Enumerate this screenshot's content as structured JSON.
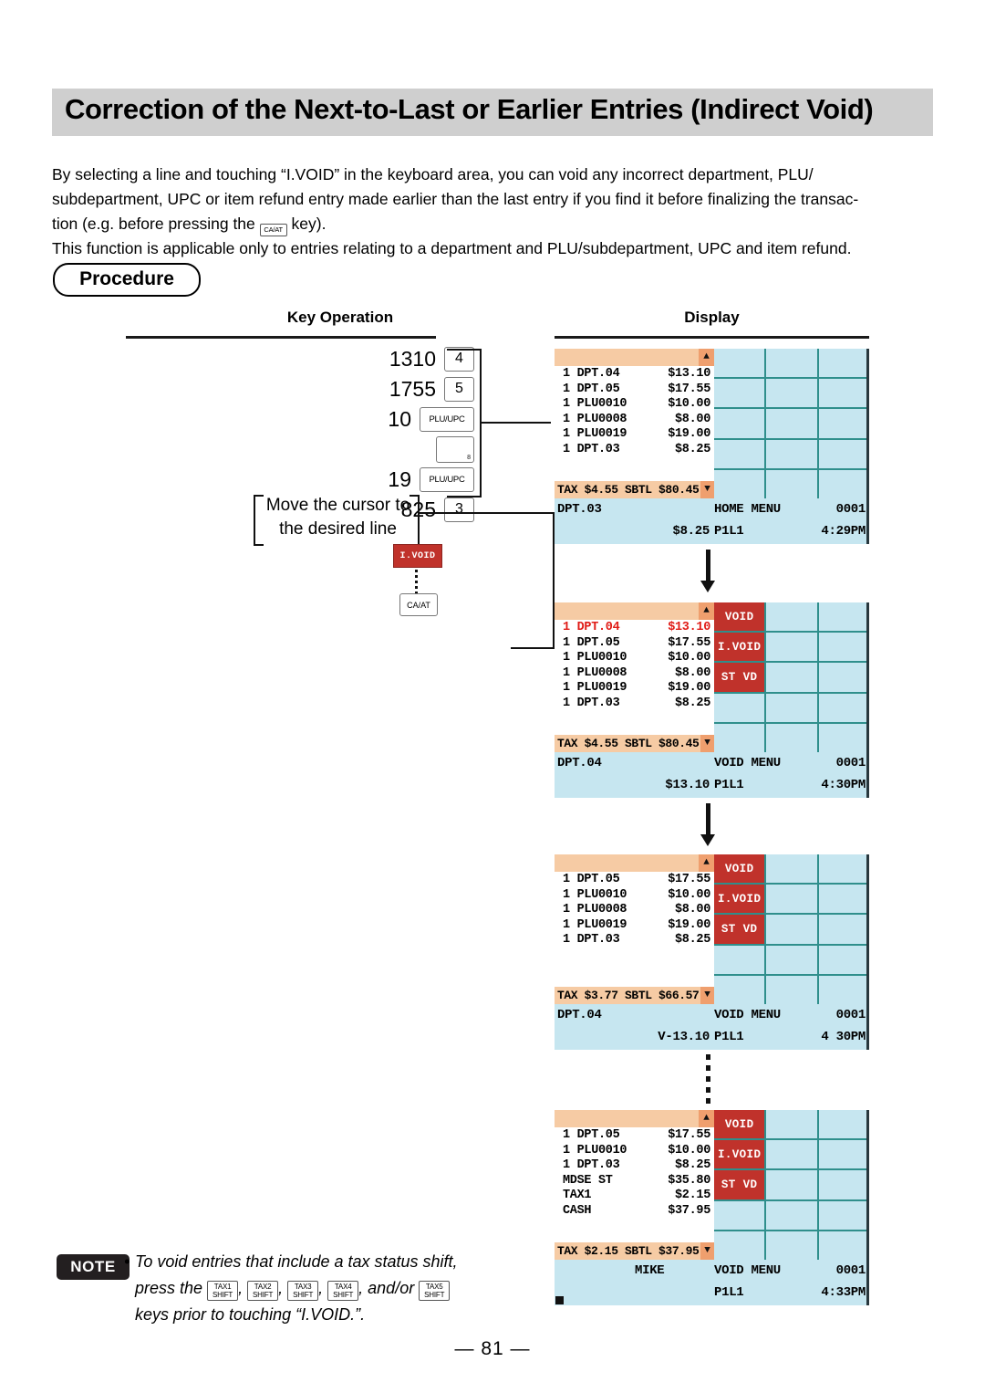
{
  "title": "Correction of the Next-to-Last or Earlier Entries (Indirect Void)",
  "intro": {
    "line1": "By selecting a line and touching “I.VOID” in the keyboard area, you can void any incorrect department, PLU/",
    "line2": "subdepartment, UPC or item refund entry made earlier than the last entry if you find it before finalizing the transac-",
    "line3_a": "tion (e.g. before pressing the",
    "line3_key": "CA/AT",
    "line3_b": "key).",
    "line4": "This function is applicable only to entries relating to a department and PLU/subdepartment, UPC and item refund."
  },
  "procedure_label": "Procedure",
  "columns": {
    "key_operation": "Key Operation",
    "display": "Display"
  },
  "key_operation": {
    "lines": [
      {
        "num": "1310",
        "key": "4",
        "style": "small"
      },
      {
        "num": "1755",
        "key": "5",
        "style": "small"
      },
      {
        "num": "10",
        "key": "PLU/UPC",
        "style": "wide"
      },
      {
        "num": "",
        "key": "",
        "style": "blank",
        "corner": "8"
      },
      {
        "num": "19",
        "key": "PLU/UPC",
        "style": "wide"
      },
      {
        "num": "825",
        "key": "3",
        "style": "small"
      }
    ],
    "cursor_note_line1": "Move the cursor to",
    "cursor_note_line2": "the desired line",
    "ivoid_key": "I.VOID",
    "caat_key": "CA/AT"
  },
  "displays": [
    {
      "name": "home-menu-display",
      "rows": [
        {
          "lbl": "1 DPT.04",
          "amt": "$13.10",
          "void": false
        },
        {
          "lbl": "1 DPT.05",
          "amt": "$17.55",
          "void": false
        },
        {
          "lbl": "1 PLU0010",
          "amt": "$10.00",
          "void": false
        },
        {
          "lbl": "1 PLU0008",
          "amt": "$8.00",
          "void": false
        },
        {
          "lbl": "1 PLU0019",
          "amt": "$19.00",
          "void": false
        },
        {
          "lbl": "1 DPT.03",
          "amt": "$8.25",
          "void": false
        }
      ],
      "taxbar": "TAX $4.55 SBTL $80.45",
      "status": {
        "left": "DPT.03",
        "amount": "$8.25",
        "menu": "HOME MENU",
        "page": "P1L1",
        "counter": "0001",
        "time": "4:29PM"
      },
      "menu_keys": [],
      "up_arrow": "▲",
      "down_arrow": "▼"
    },
    {
      "name": "void-menu-display-selected",
      "rows": [
        {
          "lbl": "1 DPT.04",
          "amt": "$13.10",
          "void": true
        },
        {
          "lbl": "1 DPT.05",
          "amt": "$17.55",
          "void": false
        },
        {
          "lbl": "1 PLU0010",
          "amt": "$10.00",
          "void": false
        },
        {
          "lbl": "1 PLU0008",
          "amt": "$8.00",
          "void": false
        },
        {
          "lbl": "1 PLU0019",
          "amt": "$19.00",
          "void": false
        },
        {
          "lbl": "1 DPT.03",
          "amt": "$8.25",
          "void": false
        }
      ],
      "taxbar": "TAX $4.55 SBTL $80.45",
      "status": {
        "left": "DPT.04",
        "amount": "$13.10",
        "menu": "VOID MENU",
        "page": "P1L1",
        "counter": "0001",
        "time": "4:30PM"
      },
      "menu_keys": [
        "VOID",
        "I.VOID",
        "ST VD"
      ],
      "up_arrow": "▲",
      "down_arrow": "▼"
    },
    {
      "name": "void-menu-display-after-void",
      "rows": [
        {
          "lbl": "1 DPT.05",
          "amt": "$17.55",
          "void": false
        },
        {
          "lbl": "1 PLU0010",
          "amt": "$10.00",
          "void": false
        },
        {
          "lbl": "1 PLU0008",
          "amt": "$8.00",
          "void": false
        },
        {
          "lbl": "1 PLU0019",
          "amt": "$19.00",
          "void": false
        },
        {
          "lbl": "1 DPT.03",
          "amt": "$8.25",
          "void": false
        }
      ],
      "taxbar": "TAX $3.77 SBTL $66.57",
      "status": {
        "left": "DPT.04",
        "amount": "V-13.10",
        "menu": "VOID MENU",
        "page": "P1L1",
        "counter": "0001",
        "time": "4 30PM"
      },
      "menu_keys": [
        "VOID",
        "I.VOID",
        "ST VD"
      ],
      "up_arrow": "▲",
      "down_arrow": "▼"
    },
    {
      "name": "void-menu-display-finalized",
      "rows": [
        {
          "lbl": "1 DPT.05",
          "amt": "$17.55",
          "void": false
        },
        {
          "lbl": "1 PLU0010",
          "amt": "$10.00",
          "void": false
        },
        {
          "lbl": "1 DPT.03",
          "amt": "$8.25",
          "void": false
        },
        {
          "lbl": "MDSE ST",
          "amt": "$35.80",
          "void": false
        },
        {
          "lbl": "TAX1",
          "amt": "$2.15",
          "void": false
        },
        {
          "lbl": "CASH",
          "amt": "$37.95",
          "void": false
        }
      ],
      "taxbar": "TAX $2.15 SBTL $37.95",
      "status": {
        "left": "MIKE",
        "amount": "",
        "menu": "VOID MENU",
        "page": "P1L1",
        "counter": "0001",
        "time": "4:33PM"
      },
      "menu_keys": [
        "VOID",
        "I.VOID",
        "ST VD"
      ],
      "up_arrow": "▲",
      "down_arrow": "▼"
    }
  ],
  "note": {
    "badge": "NOTE",
    "bullet": "•",
    "line1": "To void entries that include a tax status shift,",
    "line2_a": "press the",
    "keys": [
      {
        "top": "TAX1",
        "bottom": "SHIFT"
      },
      {
        "top": "TAX2",
        "bottom": "SHIFT"
      },
      {
        "top": "TAX3",
        "bottom": "SHIFT"
      },
      {
        "top": "TAX4",
        "bottom": "SHIFT"
      },
      {
        "top": "TAX5",
        "bottom": "SHIFT"
      }
    ],
    "comma": ",",
    "andor": ", and/or",
    "line3": "keys prior to touching “I.VOID.”."
  },
  "page_number": "— 81 —",
  "colors": {
    "title_band": "#cfcfcf",
    "keypad_cell": "#c6e6f0",
    "keypad_grid": "#2f8f8c",
    "menu_key_red": "#c0322b",
    "status_bar": "#c6e6f0",
    "tax_bar": "#f6cba4",
    "triangle": "#ef9f6e",
    "void_text": "#e01b16",
    "note_badge": "#231f20"
  }
}
